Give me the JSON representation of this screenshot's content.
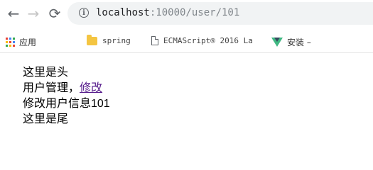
{
  "browser": {
    "url_host": "localhost",
    "url_rest": ":10000/user/101",
    "colors": {
      "omnibox_bg": "#f1f3f4",
      "apps_icon": [
        "#ea4335",
        "#4285f4",
        "#34a853",
        "#fbbc05",
        "#ea4335",
        "#4285f4",
        "#34a853",
        "#fbbc05",
        "#ea4335"
      ],
      "folder_icon": "#f4c542",
      "vue_icon": "#41b883"
    },
    "icons": {
      "back": "arrow-left-icon",
      "forward": "arrow-right-icon",
      "reload": "reload-icon",
      "info": "info-icon"
    }
  },
  "bookmarks": [
    {
      "label": "应用",
      "icon": "apps-grid-icon"
    },
    {
      "label": "spring",
      "icon": "folder-icon"
    },
    {
      "label": "ECMAScript® 2016 La",
      "icon": "page-icon"
    },
    {
      "label": "安装 –",
      "icon": "vue-logo-icon"
    }
  ],
  "page": {
    "header_text": "这里是头",
    "nav_prefix": "用户管理，",
    "nav_link": "修改",
    "body_text": "修改用户信息101",
    "footer_text": "这里是尾",
    "link_color": "#551a8b"
  }
}
